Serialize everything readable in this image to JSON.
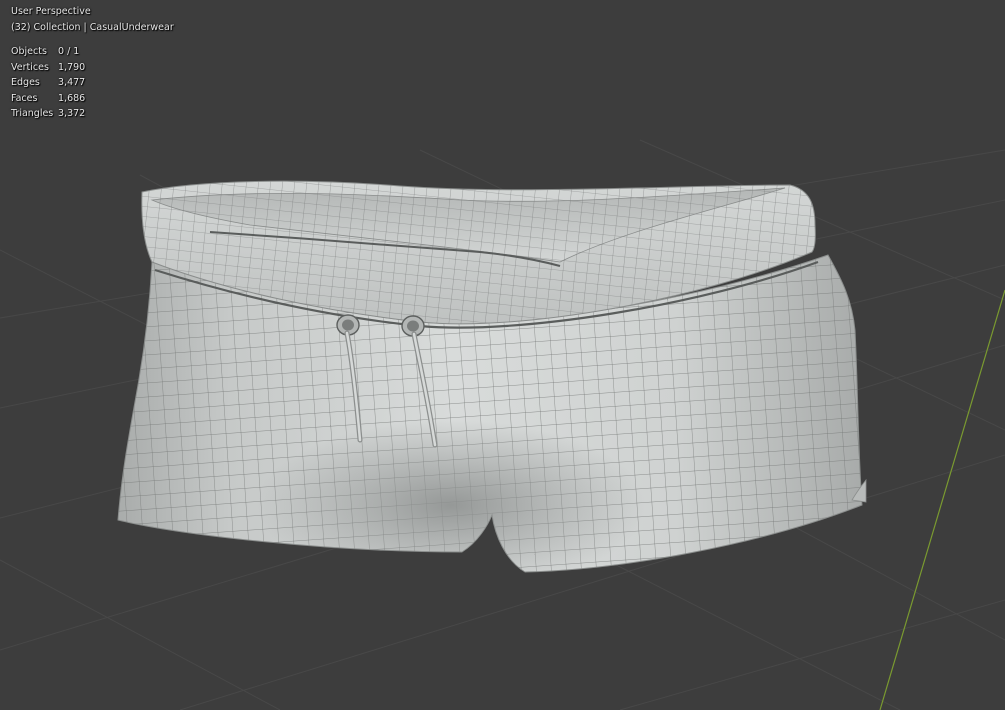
{
  "viewport": {
    "view_name": "User Perspective",
    "collection_line": "(32) Collection | CasualUnderwear",
    "stats": [
      {
        "label": "Objects",
        "value": "0 / 1"
      },
      {
        "label": "Vertices",
        "value": "1,790"
      },
      {
        "label": "Edges",
        "value": "3,477"
      },
      {
        "label": "Faces",
        "value": "1,686"
      },
      {
        "label": "Triangles",
        "value": "3,372"
      }
    ]
  },
  "colors": {
    "background": "#3d3d3d",
    "grid_line": "#4a4a4a",
    "y_axis": "#7a9a30",
    "mesh_fill": "#c9cccb",
    "wire": "#6f7271",
    "overlay_text": "#e6e6e6"
  },
  "icons": {
    "grommet_left": "grommet-icon",
    "grommet_right": "grommet-icon"
  }
}
